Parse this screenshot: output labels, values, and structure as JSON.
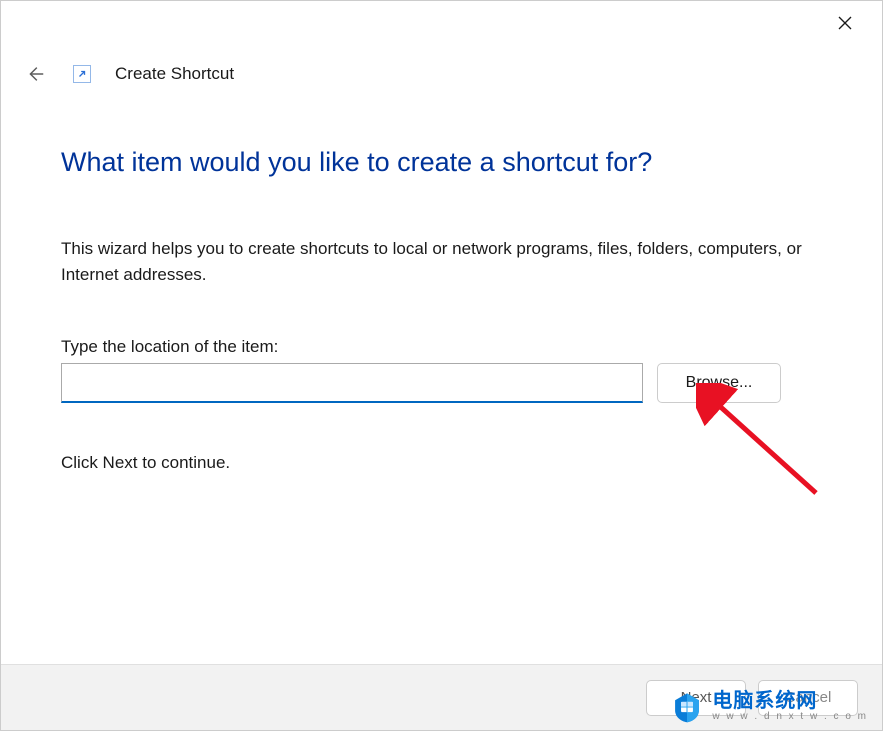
{
  "titlebar": {
    "close_icon": "close"
  },
  "header": {
    "back_icon": "back",
    "shortcut_icon": "shortcut-arrow",
    "title": "Create Shortcut"
  },
  "content": {
    "heading": "What item would you like to create a shortcut for?",
    "description": "This wizard helps you to create shortcuts to local or network programs, files, folders, computers, or Internet addresses.",
    "input_label": "Type the location of the item:",
    "input_value": "",
    "browse_label": "Browse...",
    "continue_text": "Click Next to continue."
  },
  "footer": {
    "next_label": "Next",
    "cancel_label": "Cancel"
  },
  "watermark": {
    "cn": "电脑系统网",
    "en": "w w w . d n x t w . c o m"
  },
  "annotation": {
    "arrow_color": "#e81123"
  }
}
